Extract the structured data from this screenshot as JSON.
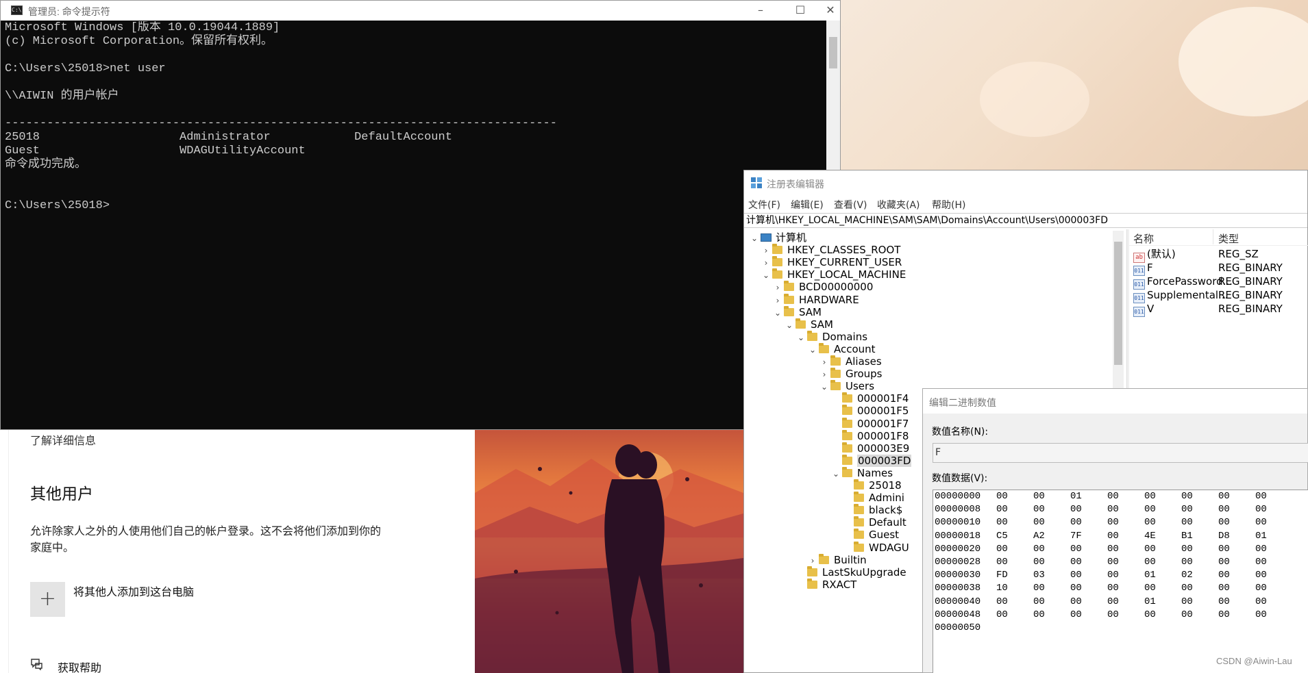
{
  "cmd": {
    "title": "管理员: 命令提示符",
    "lines": [
      "Microsoft Windows [版本 10.0.19044.1889]",
      "(c) Microsoft Corporation。保留所有权利。",
      "",
      "C:\\Users\\25018>net user",
      "",
      "\\\\AIWIN 的用户帐户",
      "",
      "-------------------------------------------------------------------------------",
      "25018                    Administrator            DefaultAccount",
      "Guest                    WDAGUtilityAccount",
      "命令成功完成。",
      "",
      "",
      "C:\\Users\\25018>"
    ]
  },
  "settings": {
    "learn_more": "了解详细信息",
    "other_users_heading": "其他用户",
    "other_users_desc_line1": "允许除家人之外的人使用他们自己的帐户登录。这不会将他们添加到你的",
    "other_users_desc_line2": "家庭中。",
    "add_user_label": "将其他人添加到这台电脑",
    "get_help": "获取帮助"
  },
  "regedit": {
    "title": "注册表编辑器",
    "menu": [
      "文件(F)",
      "编辑(E)",
      "查看(V)",
      "收藏夹(A)",
      "帮助(H)"
    ],
    "address": "计算机\\HKEY_LOCAL_MACHINE\\SAM\\SAM\\Domains\\Account\\Users\\000003FD",
    "tree": [
      {
        "label": "计算机",
        "depth": 0,
        "expander": "open",
        "icon": "computer-icon"
      },
      {
        "label": "HKEY_CLASSES_ROOT",
        "depth": 1,
        "expander": "closed"
      },
      {
        "label": "HKEY_CURRENT_USER",
        "depth": 1,
        "expander": "closed"
      },
      {
        "label": "HKEY_LOCAL_MACHINE",
        "depth": 1,
        "expander": "open"
      },
      {
        "label": "BCD00000000",
        "depth": 2,
        "expander": "closed"
      },
      {
        "label": "HARDWARE",
        "depth": 2,
        "expander": "closed"
      },
      {
        "label": "SAM",
        "depth": 2,
        "expander": "open"
      },
      {
        "label": "SAM",
        "depth": 3,
        "expander": "open"
      },
      {
        "label": "Domains",
        "depth": 4,
        "expander": "open"
      },
      {
        "label": "Account",
        "depth": 5,
        "expander": "open"
      },
      {
        "label": "Aliases",
        "depth": 6,
        "expander": "closed"
      },
      {
        "label": "Groups",
        "depth": 6,
        "expander": "closed"
      },
      {
        "label": "Users",
        "depth": 6,
        "expander": "open"
      },
      {
        "label": "000001F4",
        "depth": 7,
        "expander": "none"
      },
      {
        "label": "000001F5",
        "depth": 7,
        "expander": "none"
      },
      {
        "label": "000001F7",
        "depth": 7,
        "expander": "none"
      },
      {
        "label": "000001F8",
        "depth": 7,
        "expander": "none"
      },
      {
        "label": "000003E9",
        "depth": 7,
        "expander": "none"
      },
      {
        "label": "000003FD",
        "depth": 7,
        "expander": "none",
        "selected": true
      },
      {
        "label": "Names",
        "depth": 7,
        "expander": "open"
      },
      {
        "label": "25018",
        "depth": 8,
        "expander": "none"
      },
      {
        "label": "Admini",
        "depth": 8,
        "expander": "none"
      },
      {
        "label": "black$",
        "depth": 8,
        "expander": "none"
      },
      {
        "label": "Default",
        "depth": 8,
        "expander": "none"
      },
      {
        "label": "Guest",
        "depth": 8,
        "expander": "none"
      },
      {
        "label": "WDAGU",
        "depth": 8,
        "expander": "none"
      },
      {
        "label": "Builtin",
        "depth": 5,
        "expander": "closed"
      },
      {
        "label": "LastSkuUpgrade",
        "depth": 4,
        "expander": "none"
      },
      {
        "label": "RXACT",
        "depth": 4,
        "expander": "none"
      }
    ],
    "values_header": {
      "name": "名称",
      "type": "类型"
    },
    "values": [
      {
        "name": "(默认)",
        "type": "REG_SZ",
        "icon": "ab"
      },
      {
        "name": "F",
        "type": "REG_BINARY",
        "icon": "bin"
      },
      {
        "name": "ForcePassword...",
        "type": "REG_BINARY",
        "icon": "bin"
      },
      {
        "name": "Supplemental...",
        "type": "REG_BINARY",
        "icon": "bin"
      },
      {
        "name": "V",
        "type": "REG_BINARY",
        "icon": "bin"
      }
    ]
  },
  "binary_dialog": {
    "title": "编辑二进制数值",
    "name_label": "数值名称(N):",
    "name_value": "F",
    "data_label": "数值数据(V):",
    "rows": [
      {
        "offset": "00000000",
        "bytes": [
          "00",
          "00",
          "01",
          "00",
          "00",
          "00",
          "00",
          "00"
        ]
      },
      {
        "offset": "00000008",
        "bytes": [
          "00",
          "00",
          "00",
          "00",
          "00",
          "00",
          "00",
          "00"
        ]
      },
      {
        "offset": "00000010",
        "bytes": [
          "00",
          "00",
          "00",
          "00",
          "00",
          "00",
          "00",
          "00"
        ]
      },
      {
        "offset": "00000018",
        "bytes": [
          "C5",
          "A2",
          "7F",
          "00",
          "4E",
          "B1",
          "D8",
          "01"
        ]
      },
      {
        "offset": "00000020",
        "bytes": [
          "00",
          "00",
          "00",
          "00",
          "00",
          "00",
          "00",
          "00"
        ]
      },
      {
        "offset": "00000028",
        "bytes": [
          "00",
          "00",
          "00",
          "00",
          "00",
          "00",
          "00",
          "00"
        ]
      },
      {
        "offset": "00000030",
        "bytes": [
          "FD",
          "03",
          "00",
          "00",
          "01",
          "02",
          "00",
          "00"
        ]
      },
      {
        "offset": "00000038",
        "bytes": [
          "10",
          "00",
          "00",
          "00",
          "00",
          "00",
          "00",
          "00"
        ]
      },
      {
        "offset": "00000040",
        "bytes": [
          "00",
          "00",
          "00",
          "00",
          "01",
          "00",
          "00",
          "00"
        ]
      },
      {
        "offset": "00000048",
        "bytes": [
          "00",
          "00",
          "00",
          "00",
          "00",
          "00",
          "00",
          "00"
        ]
      },
      {
        "offset": "00000050",
        "bytes": []
      }
    ]
  },
  "watermark": "CSDN @Aiwin-Lau"
}
